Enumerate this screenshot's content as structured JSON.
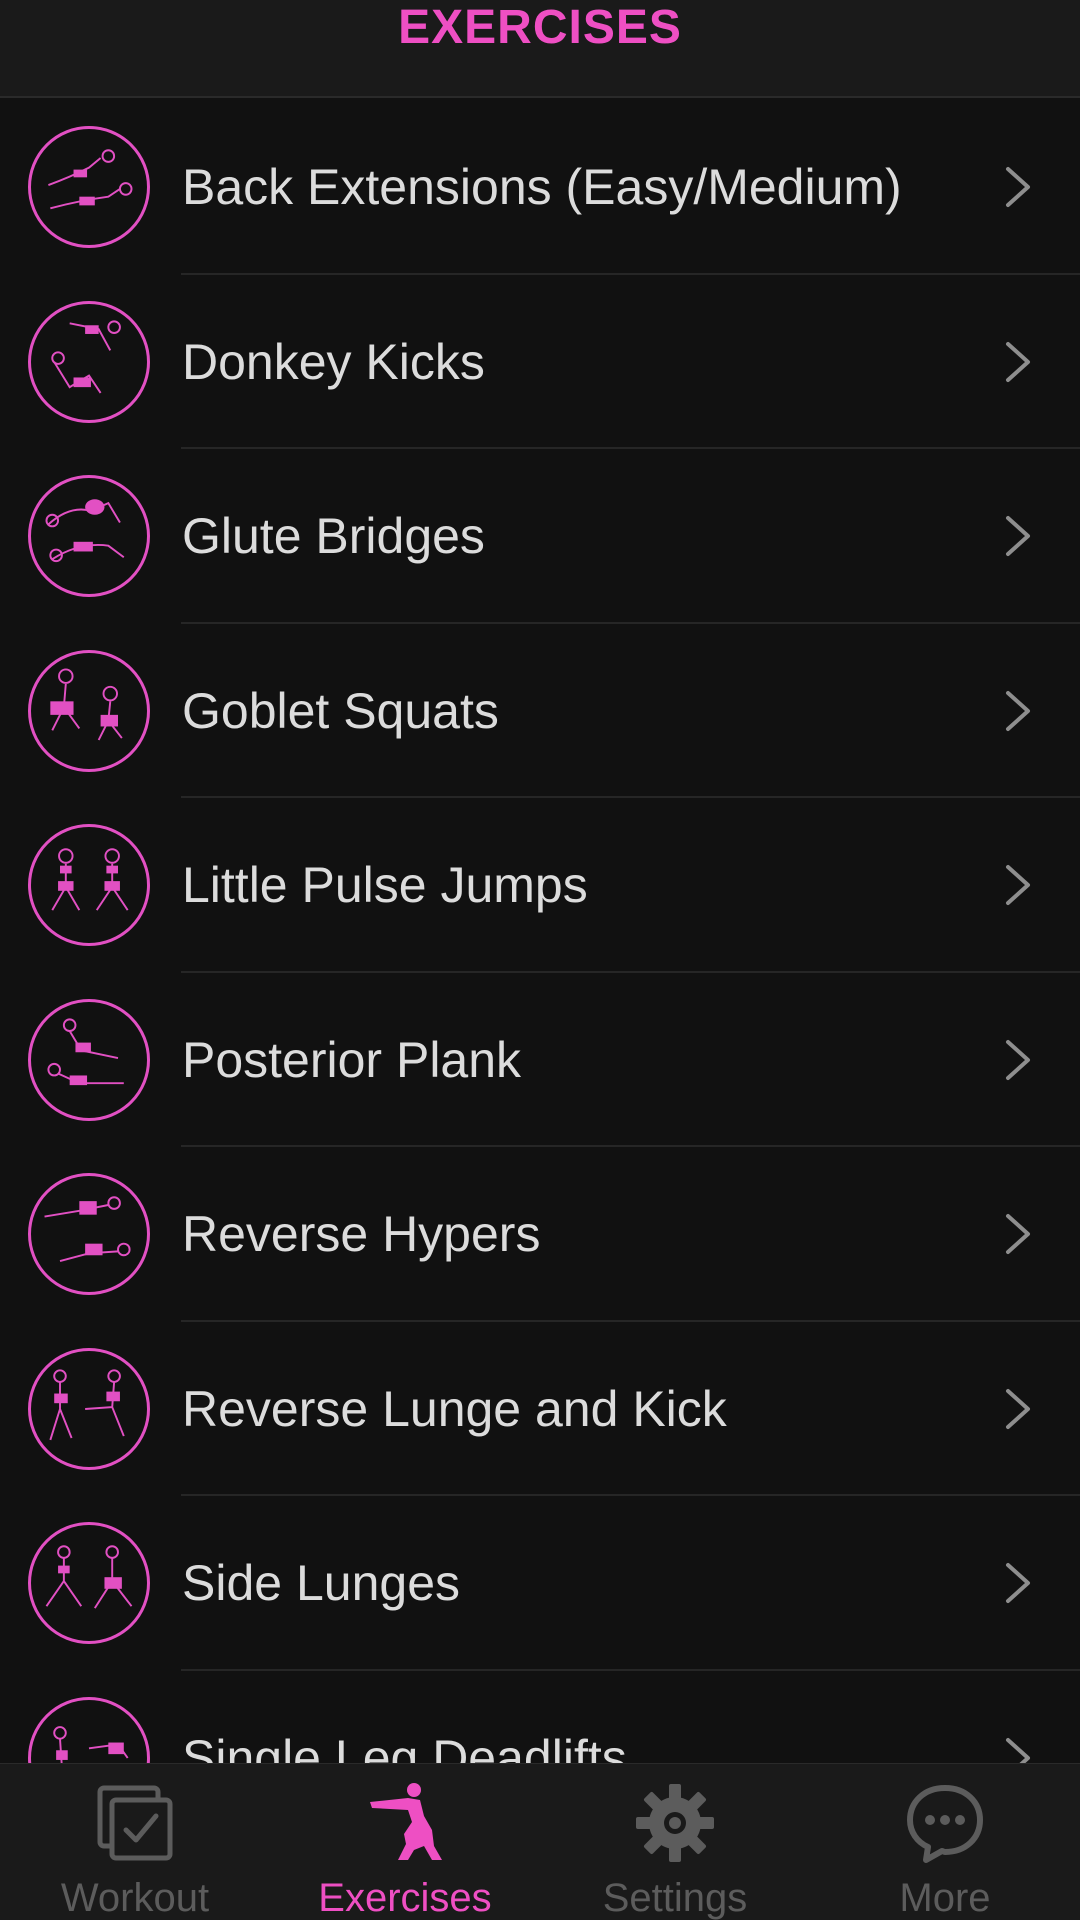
{
  "header": {
    "title": "EXERCISES"
  },
  "exercises": [
    {
      "label": "Back Extensions (Easy/Medium)",
      "icon": "back-extension-figure-icon"
    },
    {
      "label": "Donkey Kicks",
      "icon": "donkey-kick-figure-icon"
    },
    {
      "label": "Glute Bridges",
      "icon": "glute-bridge-figure-icon"
    },
    {
      "label": "Goblet Squats",
      "icon": "goblet-squat-figure-icon"
    },
    {
      "label": "Little Pulse Jumps",
      "icon": "pulse-jump-figure-icon"
    },
    {
      "label": "Posterior Plank",
      "icon": "posterior-plank-figure-icon"
    },
    {
      "label": "Reverse Hypers",
      "icon": "reverse-hyper-figure-icon"
    },
    {
      "label": "Reverse Lunge and Kick",
      "icon": "lunge-kick-figure-icon"
    },
    {
      "label": "Side Lunges",
      "icon": "side-lunge-figure-icon"
    },
    {
      "label": "Single Leg Deadlifts",
      "icon": "single-leg-deadlift-figure-icon"
    }
  ],
  "tabs": [
    {
      "label": "Workout",
      "icon": "clipboard-check-icon",
      "active": false
    },
    {
      "label": "Exercises",
      "icon": "squat-figure-icon",
      "active": true
    },
    {
      "label": "Settings",
      "icon": "gear-icon",
      "active": false
    },
    {
      "label": "More",
      "icon": "chat-bubble-dots-icon",
      "active": false
    }
  ],
  "colors": {
    "accent": "#ee4fc3",
    "background": "#111111",
    "bar": "#1a1a1a",
    "text": "#dcdcdc",
    "inactive": "#5c5c5c"
  }
}
